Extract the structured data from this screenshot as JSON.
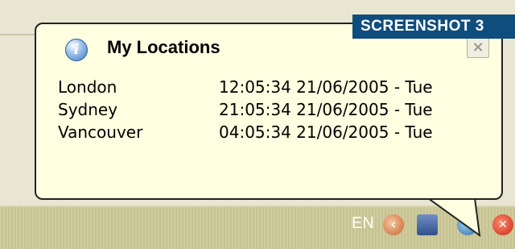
{
  "badge": {
    "label": "SCREENSHOT 3"
  },
  "balloon": {
    "title": "My Locations",
    "icon": "info-icon",
    "close_label": "×",
    "locations": [
      {
        "city": "London",
        "time": "12:05:34 21/06/2005 - Tue"
      },
      {
        "city": "Sydney",
        "time": "21:05:34 21/06/2005 - Tue"
      },
      {
        "city": "Vancouver",
        "time": "04:05:34 21/06/2005 - Tue"
      }
    ]
  },
  "taskbar": {
    "language": "EN",
    "tray_icons": [
      "back-arrow-icon",
      "network-icon",
      "globe-clock-icon",
      "stop-icon"
    ]
  },
  "colors": {
    "balloon_background": "#ffffe1",
    "badge_background": "#0f4d7d",
    "taskbar": "#cfcc9e"
  }
}
